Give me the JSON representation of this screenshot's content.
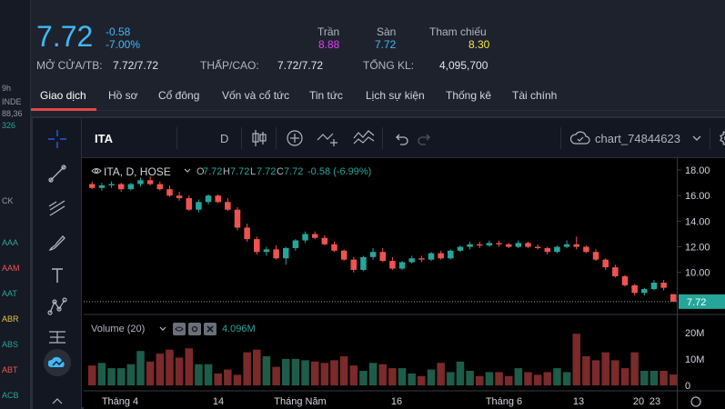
{
  "left_peek": {
    "labels": [
      "9h",
      "INDE",
      "88,36",
      "326",
      "CK",
      "AAA",
      "AAM",
      "AAT",
      "ABR",
      "ABS",
      "ABT",
      "ACB"
    ],
    "colors": [
      "#9598a1",
      "#9598a1",
      "#9598a1",
      "#26a69a",
      "#9598a1",
      "#26a69a",
      "#ef5350",
      "#26a69a",
      "#e3c33c",
      "#26a69a",
      "#ef5350",
      "#26a69a"
    ]
  },
  "header": {
    "price": "7.72",
    "change": "-0.58",
    "change_pct": "-7.00%",
    "ceiling_label": "Trần",
    "ceiling_value": "8.88",
    "floor_label": "Sàn",
    "floor_value": "7.72",
    "ref_label": "Tham chiếu",
    "ref_value": "8.30",
    "open_label": "MỞ CỬA/TB:",
    "open_value": "7.72/7.72",
    "lowhigh_label": "THẤP/CAO:",
    "lowhigh_value": "7.72/7.72",
    "volume_label": "TỔNG KL:",
    "volume_value": "4,095,700",
    "colors": {
      "price": "#42b8f5",
      "ceiling": "#e040fb",
      "floor": "#42b8f5",
      "ref": "#f5e642"
    }
  },
  "tabs": [
    "Giao dịch",
    "Hồ sơ",
    "Cổ đông",
    "Vốn và cổ tức",
    "Tin tức",
    "Lịch sự kiện",
    "Thống kê",
    "Tài chính"
  ],
  "toolbar": {
    "symbol": "ITA",
    "interval": "D",
    "chart_name": "chart_74844623"
  },
  "legend": {
    "title": "ITA, D, HOSE",
    "o_label": "O",
    "o": "7.72",
    "h_label": "H",
    "h": "7.72",
    "l_label": "L",
    "l": "7.72",
    "c_label": "C",
    "c": "7.72",
    "change": "-0.58 (-6.99%)",
    "volume_title": "Volume (20)",
    "volume_value": "4.096M"
  },
  "chart_data": {
    "type": "candlestick",
    "price_ticks": [
      "18.00",
      "16.00",
      "14.00",
      "12.00",
      "10.00",
      "8.00"
    ],
    "volume_ticks": [
      "20M",
      "10M",
      "0"
    ],
    "last_price_tag": "7.72",
    "x_ticks": [
      "Tháng 4",
      "14",
      "Tháng Năm",
      "16",
      "Tháng 6",
      "13",
      "20",
      "23"
    ],
    "up_color": "#26a69a",
    "down_color": "#ef5350",
    "candles": [
      [
        16.9,
        17.1,
        16.5,
        16.6
      ],
      [
        16.6,
        17.0,
        16.4,
        16.8
      ],
      [
        16.8,
        17.1,
        16.6,
        16.9
      ],
      [
        16.9,
        17.0,
        16.3,
        16.5
      ],
      [
        16.5,
        17.0,
        16.4,
        16.9
      ],
      [
        16.9,
        17.4,
        16.7,
        17.2
      ],
      [
        17.2,
        17.5,
        16.8,
        16.9
      ],
      [
        16.9,
        17.1,
        16.4,
        16.5
      ],
      [
        16.5,
        16.8,
        15.9,
        16.0
      ],
      [
        16.0,
        16.3,
        15.6,
        15.8
      ],
      [
        15.8,
        16.0,
        14.8,
        14.9
      ],
      [
        14.9,
        15.7,
        14.7,
        15.5
      ],
      [
        15.5,
        16.1,
        15.3,
        16.0
      ],
      [
        16.0,
        16.1,
        15.4,
        15.5
      ],
      [
        15.5,
        15.8,
        14.8,
        14.9
      ],
      [
        14.9,
        15.1,
        13.3,
        13.5
      ],
      [
        13.5,
        13.8,
        12.4,
        12.6
      ],
      [
        12.6,
        12.8,
        11.4,
        11.6
      ],
      [
        11.6,
        12.0,
        11.3,
        11.8
      ],
      [
        11.8,
        12.1,
        11.0,
        11.1
      ],
      [
        11.1,
        12.0,
        10.6,
        11.9
      ],
      [
        11.9,
        12.6,
        11.7,
        12.5
      ],
      [
        12.5,
        13.2,
        12.3,
        13.0
      ],
      [
        13.0,
        13.2,
        12.6,
        12.7
      ],
      [
        12.7,
        12.9,
        12.1,
        12.2
      ],
      [
        12.2,
        12.4,
        11.6,
        11.7
      ],
      [
        11.7,
        11.8,
        10.9,
        11.0
      ],
      [
        11.0,
        11.2,
        10.0,
        10.2
      ],
      [
        10.2,
        11.3,
        10.1,
        11.2
      ],
      [
        11.2,
        11.9,
        11.0,
        11.6
      ],
      [
        11.6,
        11.9,
        10.8,
        10.9
      ],
      [
        10.9,
        11.2,
        10.2,
        10.3
      ],
      [
        10.3,
        10.9,
        10.2,
        10.8
      ],
      [
        10.8,
        11.3,
        10.7,
        11.1
      ],
      [
        11.1,
        11.3,
        10.8,
        11.0
      ],
      [
        11.0,
        11.6,
        10.9,
        11.5
      ],
      [
        11.5,
        11.7,
        11.0,
        11.1
      ],
      [
        11.1,
        11.8,
        11.0,
        11.7
      ],
      [
        11.7,
        12.1,
        11.6,
        12.0
      ],
      [
        12.0,
        12.4,
        11.8,
        12.2
      ],
      [
        12.2,
        12.4,
        11.9,
        12.1
      ],
      [
        12.1,
        12.5,
        12.0,
        12.3
      ],
      [
        12.3,
        12.5,
        12.0,
        12.2
      ],
      [
        12.2,
        12.3,
        11.9,
        12.0
      ],
      [
        12.0,
        12.5,
        11.9,
        12.3
      ],
      [
        12.3,
        12.4,
        11.9,
        12.0
      ],
      [
        12.0,
        12.2,
        11.8,
        11.9
      ],
      [
        11.9,
        12.0,
        11.4,
        11.6
      ],
      [
        11.6,
        12.1,
        11.5,
        12.0
      ],
      [
        12.0,
        12.5,
        11.9,
        12.2
      ],
      [
        12.2,
        12.8,
        11.8,
        12.0
      ],
      [
        12.0,
        12.1,
        11.5,
        11.6
      ],
      [
        11.6,
        11.8,
        10.9,
        11.0
      ],
      [
        11.0,
        11.1,
        10.2,
        10.4
      ],
      [
        10.4,
        10.6,
        9.6,
        9.7
      ],
      [
        9.7,
        9.8,
        8.9,
        9.0
      ],
      [
        9.0,
        9.1,
        8.2,
        8.4
      ],
      [
        8.4,
        8.8,
        8.2,
        8.7
      ],
      [
        8.7,
        9.4,
        8.6,
        9.2
      ],
      [
        9.2,
        9.4,
        8.6,
        8.8
      ],
      [
        8.3,
        8.3,
        7.7,
        7.72
      ]
    ],
    "volumes": [
      [
        7.5,
        "d"
      ],
      [
        8.5,
        "u"
      ],
      [
        6.5,
        "u"
      ],
      [
        6.5,
        "u"
      ],
      [
        8.0,
        "u"
      ],
      [
        13.0,
        "u"
      ],
      [
        9.0,
        "d"
      ],
      [
        12.0,
        "d"
      ],
      [
        13.5,
        "d"
      ],
      [
        10.5,
        "d"
      ],
      [
        14.0,
        "d"
      ],
      [
        8.0,
        "u"
      ],
      [
        8.0,
        "u"
      ],
      [
        4.5,
        "d"
      ],
      [
        6.0,
        "d"
      ],
      [
        4.0,
        "d"
      ],
      [
        12.5,
        "d"
      ],
      [
        13.5,
        "d"
      ],
      [
        11.0,
        "u"
      ],
      [
        7.0,
        "d"
      ],
      [
        10.0,
        "u"
      ],
      [
        10.0,
        "u"
      ],
      [
        9.5,
        "u"
      ],
      [
        9.0,
        "d"
      ],
      [
        8.5,
        "d"
      ],
      [
        9.5,
        "d"
      ],
      [
        11.0,
        "d"
      ],
      [
        7.5,
        "d"
      ],
      [
        5.5,
        "u"
      ],
      [
        8.5,
        "u"
      ],
      [
        8.0,
        "d"
      ],
      [
        6.5,
        "d"
      ],
      [
        6.5,
        "u"
      ],
      [
        4.5,
        "u"
      ],
      [
        3.5,
        "d"
      ],
      [
        6.0,
        "u"
      ],
      [
        8.5,
        "d"
      ],
      [
        5.0,
        "u"
      ],
      [
        9.0,
        "u"
      ],
      [
        5.5,
        "u"
      ],
      [
        3.5,
        "d"
      ],
      [
        5.0,
        "u"
      ],
      [
        5.0,
        "d"
      ],
      [
        3.5,
        "d"
      ],
      [
        6.5,
        "u"
      ],
      [
        5.0,
        "d"
      ],
      [
        4.0,
        "d"
      ],
      [
        5.0,
        "d"
      ],
      [
        6.5,
        "u"
      ],
      [
        5.0,
        "u"
      ],
      [
        19.5,
        "d"
      ],
      [
        11.0,
        "d"
      ],
      [
        9.5,
        "d"
      ],
      [
        12.5,
        "d"
      ],
      [
        9.5,
        "d"
      ],
      [
        6.5,
        "d"
      ],
      [
        12.5,
        "d"
      ],
      [
        5.5,
        "u"
      ],
      [
        5.5,
        "u"
      ],
      [
        5.5,
        "d"
      ],
      [
        4.1,
        "d"
      ]
    ],
    "price_range": [
      7.0,
      18.5
    ],
    "volume_range": [
      0,
      22
    ]
  }
}
